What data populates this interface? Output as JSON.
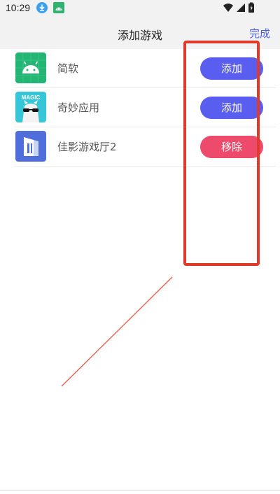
{
  "status_bar": {
    "time": "10:29",
    "icons": [
      "download-icon",
      "android-icon",
      "wifi-icon",
      "signal-icon",
      "battery-icon"
    ]
  },
  "header": {
    "title": "添加游戏",
    "done_label": "完成"
  },
  "apps": [
    {
      "name": "简软",
      "action": "添加",
      "action_type": "add",
      "icon": "android-icon"
    },
    {
      "name": "奇妙应用",
      "action": "添加",
      "action_type": "add",
      "icon": "magic-app-icon",
      "icon_text": "MAGIC"
    },
    {
      "name": "佳影游戏厅2",
      "action": "移除",
      "action_type": "remove",
      "icon": "jiaying-app-icon"
    }
  ],
  "colors": {
    "add_button": "#5a5ef0",
    "remove_button": "#ee4a6b",
    "done_text": "#4d5cf0",
    "annotation": "#e23a2a"
  }
}
